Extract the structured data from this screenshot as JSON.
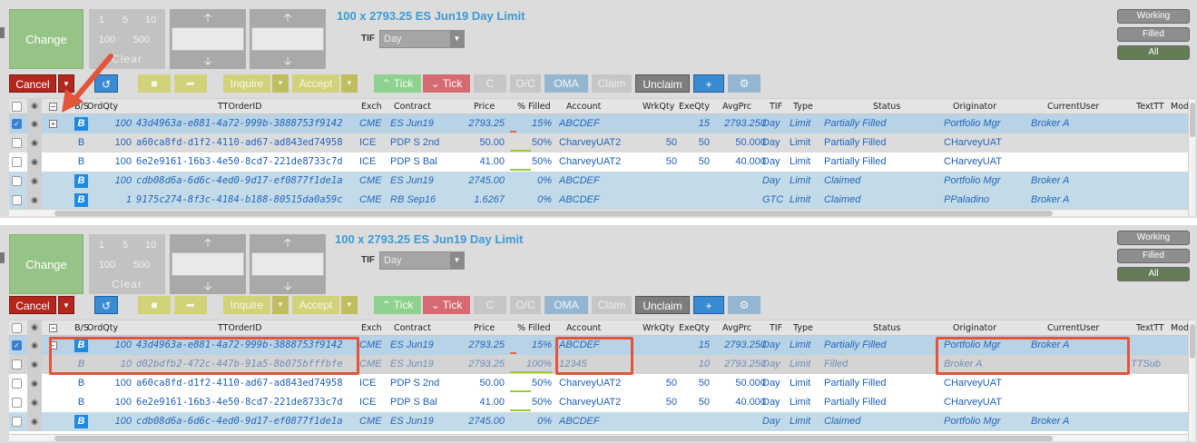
{
  "order_panel": {
    "change_label": "Change",
    "qty_buttons": [
      "1",
      "5",
      "10",
      "100",
      "500"
    ],
    "clear_label": "Clear",
    "up_arrow": "🡡",
    "down_arrow": "🡣",
    "title": "100 x 2793.25 ES Jun19 Day Limit",
    "tif_label": "TIF",
    "tif_value": "Day"
  },
  "filters": {
    "working": "Working",
    "filled": "Filled",
    "all": "All"
  },
  "toolbar": {
    "cancel": "Cancel",
    "inquire": "Inquire",
    "accept": "Accept",
    "tick_up": "Tick",
    "tick_down": "Tick",
    "oc": "O/C",
    "oma": "OMA",
    "claim": "Claim",
    "unclaim": "Unclaim",
    "plus": "+"
  },
  "columns": {
    "bs": "B/S",
    "ordqty": "OrdQty",
    "ttorderid": "TTOrderID",
    "exch": "Exch",
    "contract": "Contract",
    "price": "Price",
    "pct_filled": "% Filled",
    "account": "Account",
    "wrkqty": "WrkQty",
    "exeqty": "ExeQty",
    "avgprc": "AvgPrc",
    "tif": "TIF",
    "type": "Type",
    "status": "Status",
    "originator": "Originator",
    "currentuser": "CurrentUser",
    "texttt": "TextTT",
    "modifi": "Modifi"
  },
  "grid1": {
    "rows": [
      {
        "bs": "B",
        "ordqty": "100",
        "id": "43d4963a-e881-4a72-999b-3888753f9142",
        "exch": "CME",
        "contract": "ES Jun19",
        "price": "2793.25",
        "pct": "15%",
        "account": "ABCDEF",
        "wrk": "",
        "exe": "15",
        "avg": "2793.250",
        "tif": "Day",
        "type": "Limit",
        "status": "Partially Filled",
        "orig": "Portfolio Mgr",
        "user": "Broker  A",
        "text": ""
      },
      {
        "bs": "B",
        "ordqty": "100",
        "id": "a60ca8fd-d1f2-4110-ad67-ad843ed74958",
        "exch": "ICE",
        "contract": "PDP S 2nd",
        "price": "50.00",
        "pct": "50%",
        "account": "CharveyUAT2",
        "wrk": "50",
        "exe": "50",
        "avg": "50.000",
        "tif": "Day",
        "type": "Limit",
        "status": "Partially Filled",
        "orig": "CHarveyUAT",
        "user": "",
        "text": ""
      },
      {
        "bs": "B",
        "ordqty": "100",
        "id": "6e2e9161-16b3-4e50-8cd7-221de8733c7d",
        "exch": "ICE",
        "contract": "PDP S Bal",
        "price": "41.00",
        "pct": "50%",
        "account": "CharveyUAT2",
        "wrk": "50",
        "exe": "50",
        "avg": "40.000",
        "tif": "Day",
        "type": "Limit",
        "status": "Partially Filled",
        "orig": "CHarveyUAT",
        "user": "",
        "text": ""
      },
      {
        "bs": "B",
        "ordqty": "100",
        "id": "cdb08d6a-6d6c-4ed0-9d17-ef0877f1de1a",
        "exch": "CME",
        "contract": "ES Jun19",
        "price": "2745.00",
        "pct": "0%",
        "account": "ABCDEF",
        "wrk": "",
        "exe": "",
        "avg": "",
        "tif": "Day",
        "type": "Limit",
        "status": "Claimed",
        "orig": "Portfolio Mgr",
        "user": "Broker  A",
        "text": ""
      },
      {
        "bs": "B",
        "ordqty": "1",
        "id": "9175c274-8f3c-4184-b188-80515da0a59c",
        "exch": "CME",
        "contract": "RB Sep16",
        "price": "1.6267",
        "pct": "0%",
        "account": "ABCDEF",
        "wrk": "",
        "exe": "",
        "avg": "",
        "tif": "GTC",
        "type": "Limit",
        "status": "Claimed",
        "orig": "PPaladino",
        "user": "Broker  A",
        "text": ""
      }
    ]
  },
  "grid2": {
    "rows": [
      {
        "bs": "B",
        "ordqty": "100",
        "id": "43d4963a-e881-4a72-999b-3888753f9142",
        "exch": "CME",
        "contract": "ES Jun19",
        "price": "2793.25",
        "pct": "15%",
        "account": "ABCDEF",
        "wrk": "",
        "exe": "15",
        "avg": "2793.250",
        "tif": "Day",
        "type": "Limit",
        "status": "Partially Filled",
        "orig": "Portfolio Mgr",
        "user": "Broker  A",
        "text": ""
      },
      {
        "bs": "B",
        "ordqty": "10",
        "id": "d02bdfb2-472c-447b-91a5-8b075bfffbfe",
        "exch": "CME",
        "contract": "ES Jun19",
        "price": "2793.25",
        "pct": "100%",
        "account": "12345",
        "wrk": "",
        "exe": "10",
        "avg": "2793.250",
        "tif": "Day",
        "type": "Limit",
        "status": "Filled",
        "orig": "Broker  A",
        "user": "",
        "text": "TTSub"
      },
      {
        "bs": "B",
        "ordqty": "100",
        "id": "a60ca8fd-d1f2-4110-ad67-ad843ed74958",
        "exch": "ICE",
        "contract": "PDP S 2nd",
        "price": "50.00",
        "pct": "50%",
        "account": "CharveyUAT2",
        "wrk": "50",
        "exe": "50",
        "avg": "50.000",
        "tif": "Day",
        "type": "Limit",
        "status": "Partially Filled",
        "orig": "CHarveyUAT",
        "user": "",
        "text": ""
      },
      {
        "bs": "B",
        "ordqty": "100",
        "id": "6e2e9161-16b3-4e50-8cd7-221de8733c7d",
        "exch": "ICE",
        "contract": "PDP S Bal",
        "price": "41.00",
        "pct": "50%",
        "account": "CharveyUAT2",
        "wrk": "50",
        "exe": "50",
        "avg": "40.000",
        "tif": "Day",
        "type": "Limit",
        "status": "Partially Filled",
        "orig": "CHarveyUAT",
        "user": "",
        "text": ""
      },
      {
        "bs": "B",
        "ordqty": "100",
        "id": "cdb08d6a-6d6c-4ed0-9d17-ef0877f1de1a",
        "exch": "CME",
        "contract": "ES Jun19",
        "price": "2745.00",
        "pct": "0%",
        "account": "ABCDEF",
        "wrk": "",
        "exe": "",
        "avg": "",
        "tif": "Day",
        "type": "Limit",
        "status": "Claimed",
        "orig": "Portfolio Mgr",
        "user": "Broker  A",
        "text": ""
      }
    ]
  },
  "colors": {
    "accent_blue": "#1e8ae0",
    "cancel_red": "#b3261e",
    "callout": "#e2553a",
    "title_blue": "#3a9bd6"
  }
}
